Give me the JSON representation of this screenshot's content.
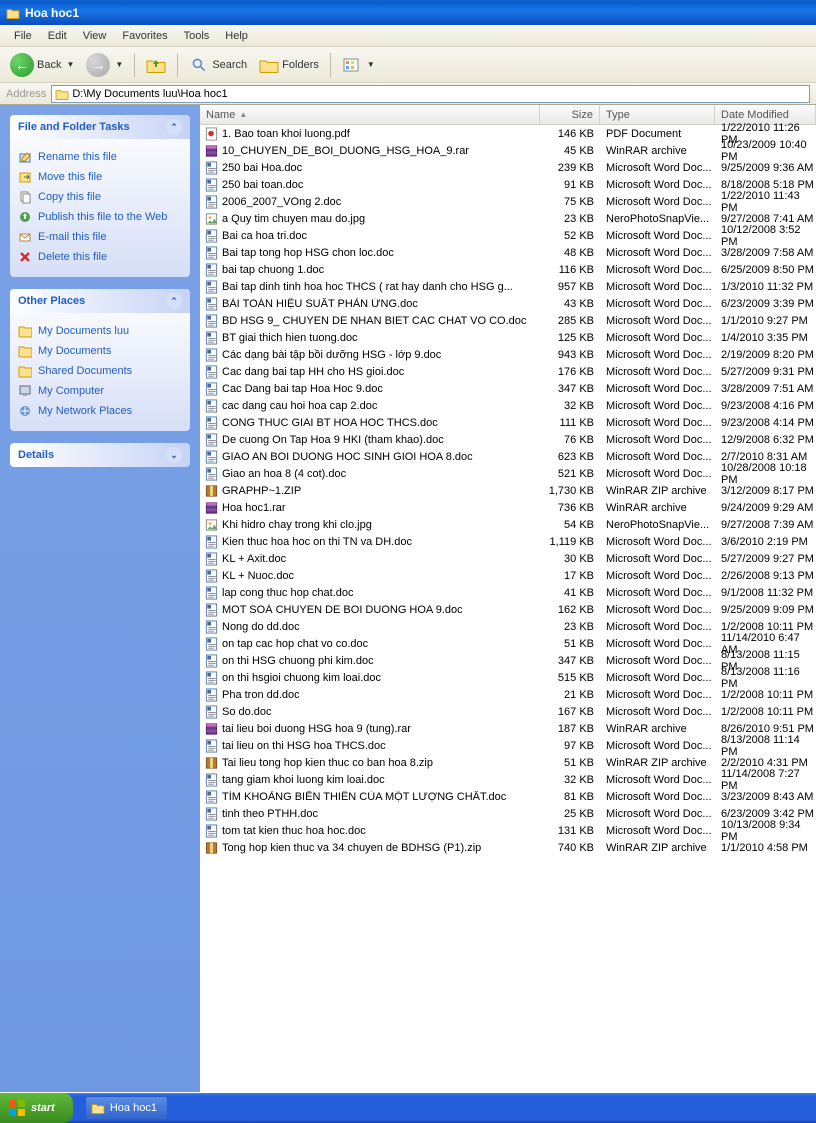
{
  "window_title": "Hoa hoc1",
  "menus": [
    "File",
    "Edit",
    "View",
    "Favorites",
    "Tools",
    "Help"
  ],
  "toolbar": {
    "back": "Back",
    "search": "Search",
    "folders": "Folders"
  },
  "address_label": "Address",
  "path": "D:\\My Documents luu\\Hoa hoc1",
  "panels": {
    "tasks": {
      "title": "File and Folder Tasks",
      "items": [
        {
          "label": "Rename this file",
          "ico": "rename"
        },
        {
          "label": "Move this file",
          "ico": "move"
        },
        {
          "label": "Copy this file",
          "ico": "copy"
        },
        {
          "label": "Publish this file to the Web",
          "ico": "publish"
        },
        {
          "label": "E-mail this file",
          "ico": "email"
        },
        {
          "label": "Delete this file",
          "ico": "delete"
        }
      ]
    },
    "places": {
      "title": "Other Places",
      "items": [
        {
          "label": "My Documents luu",
          "ico": "folder"
        },
        {
          "label": "My Documents",
          "ico": "folder"
        },
        {
          "label": "Shared Documents",
          "ico": "folder"
        },
        {
          "label": "My Computer",
          "ico": "computer"
        },
        {
          "label": "My Network Places",
          "ico": "network"
        }
      ]
    },
    "details": {
      "title": "Details"
    }
  },
  "columns": {
    "name": "Name",
    "size": "Size",
    "type": "Type",
    "date": "Date Modified"
  },
  "files": [
    {
      "name": "1. Bao toan khoi luong.pdf",
      "size": "146 KB",
      "type": "PDF Document",
      "date": "1/22/2010 11:26 PM",
      "ico": "pdf"
    },
    {
      "name": "10_CHUYEN_DE_BOI_DUONG_HSG_HOA_9.rar",
      "size": "45 KB",
      "type": "WinRAR archive",
      "date": "10/23/2009 10:40 PM",
      "ico": "rar"
    },
    {
      "name": "250 bai Hoa.doc",
      "size": "239 KB",
      "type": "Microsoft Word Doc...",
      "date": "9/25/2009 9:36 AM",
      "ico": "doc"
    },
    {
      "name": "250 bai toan.doc",
      "size": "91 KB",
      "type": "Microsoft Word Doc...",
      "date": "8/18/2008 5:18 PM",
      "ico": "doc"
    },
    {
      "name": "2006_2007_VOng 2.doc",
      "size": "75 KB",
      "type": "Microsoft Word Doc...",
      "date": "1/22/2010 11:43 PM",
      "ico": "doc"
    },
    {
      "name": "a Quy tim chuyen mau do.jpg",
      "size": "23 KB",
      "type": "NeroPhotoSnapVie...",
      "date": "9/27/2008 7:41 AM",
      "ico": "img"
    },
    {
      "name": "Bai ca hoa tri.doc",
      "size": "52 KB",
      "type": "Microsoft Word Doc...",
      "date": "10/12/2008 3:52 PM",
      "ico": "doc"
    },
    {
      "name": "Bai tap  tong hop HSG chon loc.doc",
      "size": "48 KB",
      "type": "Microsoft Word Doc...",
      "date": "3/28/2009 7:58 AM",
      "ico": "doc"
    },
    {
      "name": "bai tap chuong 1.doc",
      "size": "116 KB",
      "type": "Microsoft Word Doc...",
      "date": "6/25/2009 8:50 PM",
      "ico": "doc"
    },
    {
      "name": "Bai tap dinh tinh hoa hoc THCS ( rat hay danh cho HSG g...",
      "size": "957 KB",
      "type": "Microsoft Word Doc...",
      "date": "1/3/2010 11:32 PM",
      "ico": "doc"
    },
    {
      "name": "BÀI TOÁN HIỆU SUẤT PHẢN ỨNG.doc",
      "size": "43 KB",
      "type": "Microsoft Word Doc...",
      "date": "6/23/2009 3:39 PM",
      "ico": "doc"
    },
    {
      "name": "BD HSG 9_ CHUYEN DE NHAN BIET CAC CHAT VO CO.doc",
      "size": "285 KB",
      "type": "Microsoft Word Doc...",
      "date": "1/1/2010 9:27 PM",
      "ico": "doc"
    },
    {
      "name": "BT giai thich hien tuong.doc",
      "size": "125 KB",
      "type": "Microsoft Word Doc...",
      "date": "1/4/2010 3:35 PM",
      "ico": "doc"
    },
    {
      "name": "Các dạng bài tập bồi dưỡng HSG - lớp 9.doc",
      "size": "943 KB",
      "type": "Microsoft Word Doc...",
      "date": "2/19/2009 8:20 PM",
      "ico": "doc"
    },
    {
      "name": "Cac dang bai tap HH cho HS gioi.doc",
      "size": "176 KB",
      "type": "Microsoft Word Doc...",
      "date": "5/27/2009 9:31 PM",
      "ico": "doc"
    },
    {
      "name": "Cac Dang bai tap Hoa Hoc 9.doc",
      "size": "347 KB",
      "type": "Microsoft Word Doc...",
      "date": "3/28/2009 7:51 AM",
      "ico": "doc"
    },
    {
      "name": "cac dang cau hoi hoa cap 2.doc",
      "size": "32 KB",
      "type": "Microsoft Word Doc...",
      "date": "9/23/2008 4:16 PM",
      "ico": "doc"
    },
    {
      "name": "CONG THUC GIAI BT HOA HOC THCS.doc",
      "size": "111 KB",
      "type": "Microsoft Word Doc...",
      "date": "9/23/2008 4:14 PM",
      "ico": "doc"
    },
    {
      "name": "De cuong On Tap Hoa 9 HKI (tham khao).doc",
      "size": "76 KB",
      "type": "Microsoft Word Doc...",
      "date": "12/9/2008 6:32 PM",
      "ico": "doc"
    },
    {
      "name": "GIAO AN BOI DUONG HOC SINH GIOI HOA 8.doc",
      "size": "623 KB",
      "type": "Microsoft Word Doc...",
      "date": "2/7/2010 8:31 AM",
      "ico": "doc"
    },
    {
      "name": "Giao an hoa 8 (4 cot).doc",
      "size": "521 KB",
      "type": "Microsoft Word Doc...",
      "date": "10/28/2008 10:18 PM",
      "ico": "doc"
    },
    {
      "name": "GRAPHP~1.ZIP",
      "size": "1,730 KB",
      "type": "WinRAR ZIP archive",
      "date": "3/12/2009 8:17 PM",
      "ico": "zip"
    },
    {
      "name": "Hoa hoc1.rar",
      "size": "736 KB",
      "type": "WinRAR archive",
      "date": "9/24/2009 9:29 AM",
      "ico": "rar"
    },
    {
      "name": "Khi hidro chay trong khi clo.jpg",
      "size": "54 KB",
      "type": "NeroPhotoSnapVie...",
      "date": "9/27/2008 7:39 AM",
      "ico": "img"
    },
    {
      "name": "Kien thuc hoa hoc  on thi TN va DH.doc",
      "size": "1,119 KB",
      "type": "Microsoft Word Doc...",
      "date": "3/6/2010 2:19 PM",
      "ico": "doc"
    },
    {
      "name": "KL + Axit.doc",
      "size": "30 KB",
      "type": "Microsoft Word Doc...",
      "date": "5/27/2009 9:27 PM",
      "ico": "doc"
    },
    {
      "name": "KL + Nuoc.doc",
      "size": "17 KB",
      "type": "Microsoft Word Doc...",
      "date": "2/26/2008 9:13 PM",
      "ico": "doc"
    },
    {
      "name": "lap cong thuc hop chat.doc",
      "size": "41 KB",
      "type": "Microsoft Word Doc...",
      "date": "9/1/2008 11:32 PM",
      "ico": "doc"
    },
    {
      "name": "MOT SOÁ CHUYEN DE BOI DUONG HOA 9.doc",
      "size": "162 KB",
      "type": "Microsoft Word Doc...",
      "date": "9/25/2009 9:09 PM",
      "ico": "doc"
    },
    {
      "name": "Nong do dd.doc",
      "size": "23 KB",
      "type": "Microsoft Word Doc...",
      "date": "1/2/2008 10:11 PM",
      "ico": "doc"
    },
    {
      "name": "on tap cac hop chat vo co.doc",
      "size": "51 KB",
      "type": "Microsoft Word Doc...",
      "date": "11/14/2010 6:47 AM",
      "ico": "doc"
    },
    {
      "name": "on thi HSG chuong phi kim.doc",
      "size": "347 KB",
      "type": "Microsoft Word Doc...",
      "date": "8/13/2008 11:15 PM",
      "ico": "doc"
    },
    {
      "name": "on thi hsgioi  chuong kim loai.doc",
      "size": "515 KB",
      "type": "Microsoft Word Doc...",
      "date": "8/13/2008 11:16 PM",
      "ico": "doc"
    },
    {
      "name": "Pha tron dd.doc",
      "size": "21 KB",
      "type": "Microsoft Word Doc...",
      "date": "1/2/2008 10:11 PM",
      "ico": "doc"
    },
    {
      "name": "So do.doc",
      "size": "167 KB",
      "type": "Microsoft Word Doc...",
      "date": "1/2/2008 10:11 PM",
      "ico": "doc"
    },
    {
      "name": "tai lieu boi duong HSG hoa 9 (tung).rar",
      "size": "187 KB",
      "type": "WinRAR archive",
      "date": "8/26/2010 9:51 PM",
      "ico": "rar"
    },
    {
      "name": "tai lieu on thi HSG hoa THCS.doc",
      "size": "97 KB",
      "type": "Microsoft Word Doc...",
      "date": "8/13/2008 11:14 PM",
      "ico": "doc"
    },
    {
      "name": "Tai lieu tong hop kien thuc co ban hoa 8.zip",
      "size": "51 KB",
      "type": "WinRAR ZIP archive",
      "date": "2/2/2010 4:31 PM",
      "ico": "zip"
    },
    {
      "name": "tang giam khoi luong kim loai.doc",
      "size": "32 KB",
      "type": "Microsoft Word Doc...",
      "date": "11/14/2008 7:27 PM",
      "ico": "doc"
    },
    {
      "name": "TÌM KHOẢNG BIẾN THIÊN CỦA MỘT LƯỢNG CHẤT.doc",
      "size": "81 KB",
      "type": "Microsoft Word Doc...",
      "date": "3/23/2009 8:43 AM",
      "ico": "doc"
    },
    {
      "name": "tinh theo PTHH.doc",
      "size": "25 KB",
      "type": "Microsoft Word Doc...",
      "date": "6/23/2009 3:42 PM",
      "ico": "doc"
    },
    {
      "name": "tom tat kien thuc hoa hoc.doc",
      "size": "131 KB",
      "type": "Microsoft Word Doc...",
      "date": "10/13/2008 9:34 PM",
      "ico": "doc"
    },
    {
      "name": "Tong hop kien thuc va 34 chuyen de BDHSG (P1).zip",
      "size": "740 KB",
      "type": "WinRAR ZIP archive",
      "date": "1/1/2010 4:58 PM",
      "ico": "zip"
    }
  ],
  "taskbar": {
    "start": "start",
    "task": "Hoa hoc1"
  }
}
